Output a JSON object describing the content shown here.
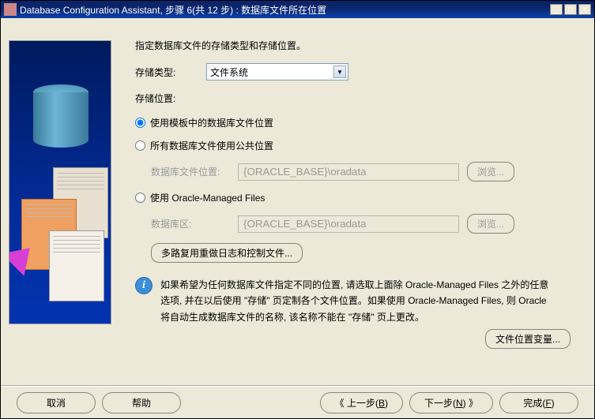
{
  "title": "Database Configuration Assistant, 步骤 6(共 12 步) : 数据库文件所在位置",
  "intro": "指定数据库文件的存储类型和存储位置。",
  "storage_type_label": "存储类型:",
  "storage_type_value": "文件系统",
  "storage_location_label": "存储位置:",
  "radio": {
    "template": "使用模板中的数据库文件位置",
    "common": "所有数据库文件使用公共位置",
    "omf": "使用 Oracle-Managed Files"
  },
  "common_location_label": "数据库文件位置:",
  "common_location_value": "{ORACLE_BASE}\\oradata",
  "db_area_label": "数据库区:",
  "db_area_value": "{ORACLE_BASE}\\oradata",
  "browse_label": "浏览...",
  "multiplex_label": "多路复用重做日志和控制文件...",
  "info_text": "如果希望为任何数据库文件指定不同的位置, 请选取上面除 Oracle-Managed Files 之外的任意选项, 并在以后使用 \"存储\" 页定制各个文件位置。如果使用 Oracle-Managed Files, 则 Oracle 将自动生成数据库文件的名称, 该名称不能在 \"存储\" 页上更改。",
  "file_loc_vars": "文件位置变量...",
  "footer": {
    "cancel": "取消",
    "help": "帮助",
    "back_prefix": "《  上一步(",
    "back_key": "B",
    "back_suffix": ")",
    "next_prefix": "下一步(",
    "next_key": "N",
    "next_suffix": ")  》",
    "finish_prefix": "完成(",
    "finish_key": "F",
    "finish_suffix": ")"
  }
}
